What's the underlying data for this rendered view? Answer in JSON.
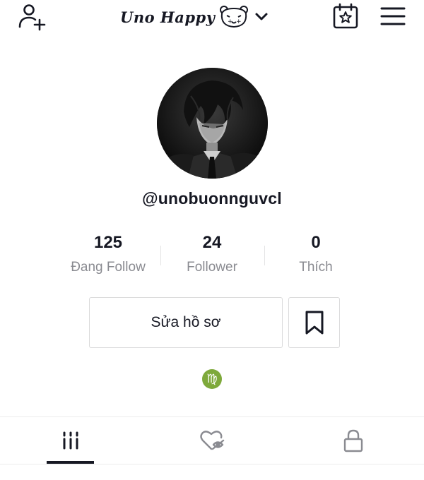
{
  "header": {
    "display_name": "Uno Happy",
    "add_user_icon": "add-user-icon",
    "bear_icon": "bear-face-icon",
    "chevron_icon": "chevron-down-icon",
    "calendar_icon": "calendar-star-icon",
    "menu_icon": "hamburger-menu-icon"
  },
  "profile": {
    "avatar_icon": "avatar-image",
    "username": "@unobuonnguvcl"
  },
  "stats": [
    {
      "value": "125",
      "label": "Đang Follow"
    },
    {
      "value": "24",
      "label": "Follower"
    },
    {
      "value": "0",
      "label": "Thích"
    }
  ],
  "actions": {
    "edit_profile_label": "Sửa hồ sơ",
    "bookmark_icon": "bookmark-icon"
  },
  "bio": {
    "zodiac_symbol": "♍",
    "zodiac_color": "#7ea93b"
  },
  "tabs": [
    {
      "icon": "videos-grid-icon",
      "active": true
    },
    {
      "icon": "liked-hidden-icon",
      "active": false
    },
    {
      "icon": "lock-icon",
      "active": false
    }
  ],
  "colors": {
    "primary_text": "#161823",
    "secondary_text": "#8a8b91",
    "border": "#dadadb"
  }
}
